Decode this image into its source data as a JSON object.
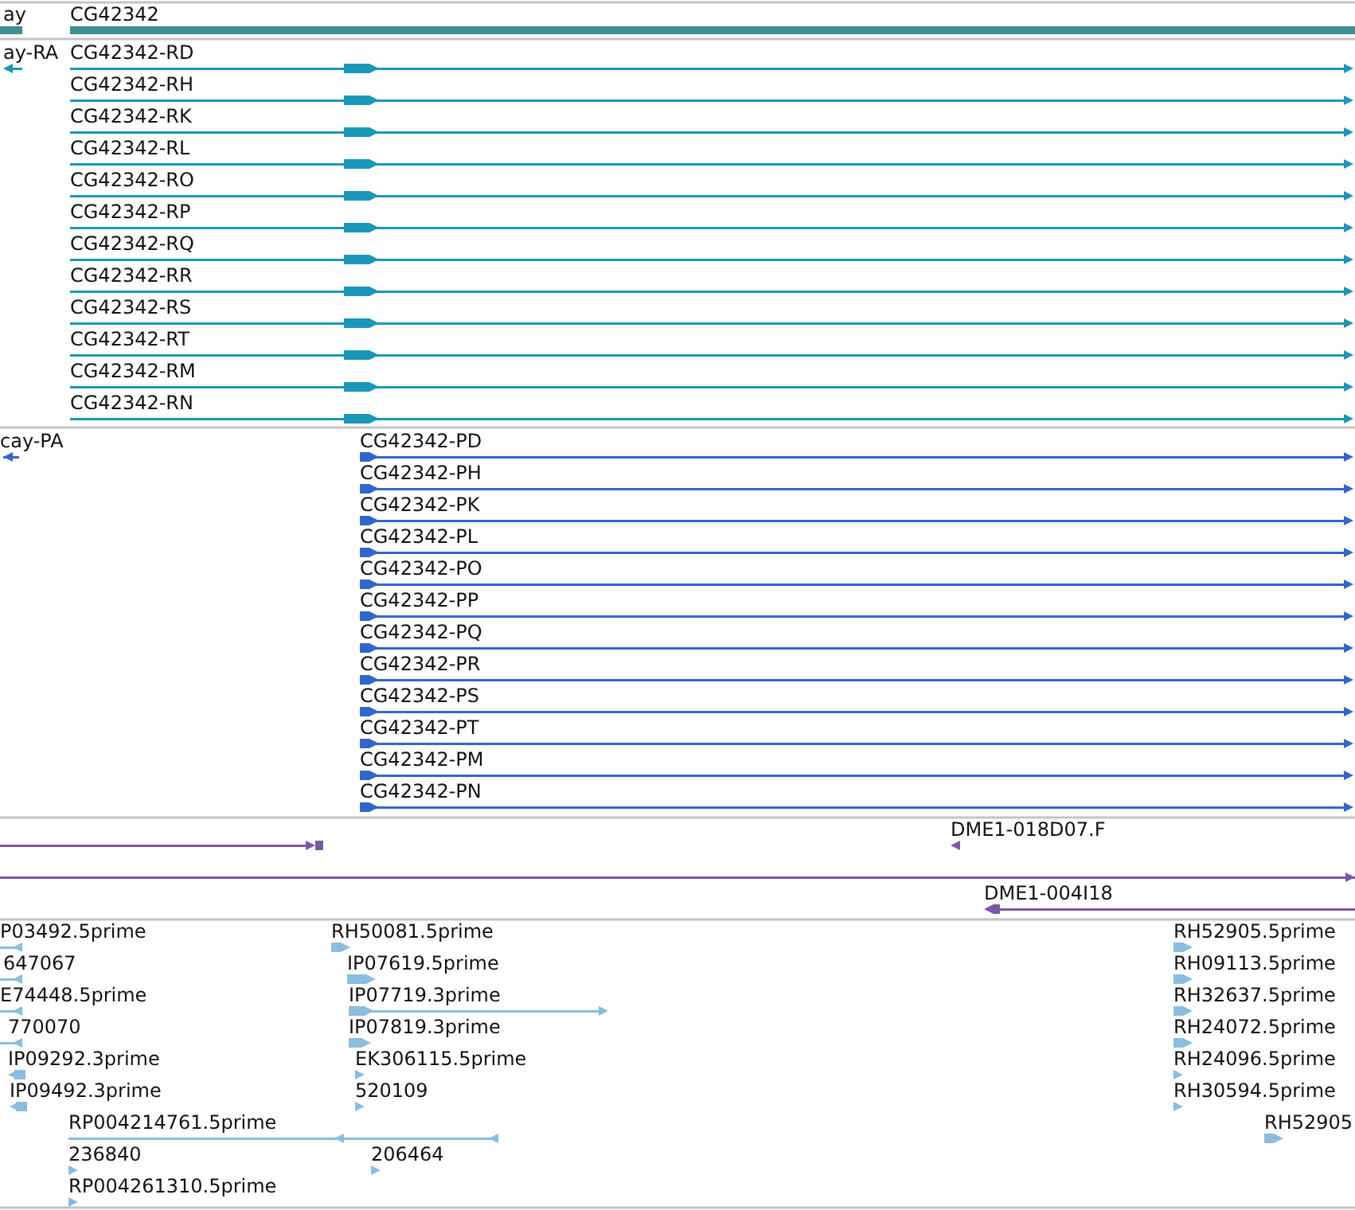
{
  "tracks": [
    {
      "kind": "gene",
      "features": [
        {
          "label": "ay"
        },
        {
          "label": "CG42342"
        }
      ]
    },
    {
      "kind": "transcript",
      "features": [
        {
          "label": "ay-RA",
          "reverse": true
        },
        {
          "label": "CG42342-RD",
          "reverse": false
        },
        {
          "label": "CG42342-RH",
          "reverse": false
        },
        {
          "label": "CG42342-RK",
          "reverse": false
        },
        {
          "label": "CG42342-RL",
          "reverse": false
        },
        {
          "label": "CG42342-RO",
          "reverse": false
        },
        {
          "label": "CG42342-RP",
          "reverse": false
        },
        {
          "label": "CG42342-RQ",
          "reverse": false
        },
        {
          "label": "CG42342-RR",
          "reverse": false
        },
        {
          "label": "CG42342-RS",
          "reverse": false
        },
        {
          "label": "CG42342-RT",
          "reverse": false
        },
        {
          "label": "CG42342-RM",
          "reverse": false
        },
        {
          "label": "CG42342-RN",
          "reverse": false
        }
      ]
    },
    {
      "kind": "protein",
      "features": [
        {
          "label": "cay-PA",
          "reverse": true
        },
        {
          "label": "CG42342-PD",
          "reverse": false
        },
        {
          "label": "CG42342-PH",
          "reverse": false
        },
        {
          "label": "CG42342-PK",
          "reverse": false
        },
        {
          "label": "CG42342-PL",
          "reverse": false
        },
        {
          "label": "CG42342-PO",
          "reverse": false
        },
        {
          "label": "CG42342-PP",
          "reverse": false
        },
        {
          "label": "CG42342-PQ",
          "reverse": false
        },
        {
          "label": "CG42342-PR",
          "reverse": false
        },
        {
          "label": "CG42342-PS",
          "reverse": false
        },
        {
          "label": "CG42342-PT",
          "reverse": false
        },
        {
          "label": "CG42342-PM",
          "reverse": false
        },
        {
          "label": "CG42342-PN",
          "reverse": false
        }
      ]
    },
    {
      "kind": "clone",
      "features": [
        {
          "reverse": false
        },
        {
          "label": "DME1-018D07.F",
          "reverse": true
        },
        {
          "reverse": false
        },
        {
          "label": "DME1-004I18",
          "reverse": true
        }
      ]
    },
    {
      "kind": "est",
      "features": [
        {
          "label": "P03492.5prime",
          "reverse": true
        },
        {
          "label": "647067",
          "reverse": true
        },
        {
          "label": "E74448.5prime",
          "reverse": true
        },
        {
          "label": "770070",
          "reverse": true
        },
        {
          "label": "IP09292.3prime",
          "reverse": true
        },
        {
          "label": "IP09492.3prime",
          "reverse": true
        },
        {
          "label": "RP004214761.5prime",
          "reverse": true
        },
        {
          "label": "236840",
          "reverse": false
        },
        {
          "label": "RP004261310.5prime",
          "reverse": false
        },
        {
          "label": "RH50081.5prime",
          "reverse": false
        },
        {
          "label": "IP07619.5prime",
          "reverse": false
        },
        {
          "label": "IP07719.3prime",
          "reverse": false
        },
        {
          "label": "IP07819.3prime",
          "reverse": false
        },
        {
          "label": "EK306115.5prime",
          "reverse": false
        },
        {
          "label": "520109",
          "reverse": false
        },
        {
          "label": "206464",
          "reverse": false
        },
        {
          "label": "RH52905.5prime",
          "reverse": false
        },
        {
          "label": "RH09113.5prime",
          "reverse": false
        },
        {
          "label": "RH32637.5prime",
          "reverse": false
        },
        {
          "label": "RH24072.5prime",
          "reverse": false
        },
        {
          "label": "RH24096.5prime",
          "reverse": false
        },
        {
          "label": "RH30594.5prime",
          "reverse": false
        },
        {
          "label": "RH52905",
          "reverse": false
        }
      ]
    }
  ]
}
